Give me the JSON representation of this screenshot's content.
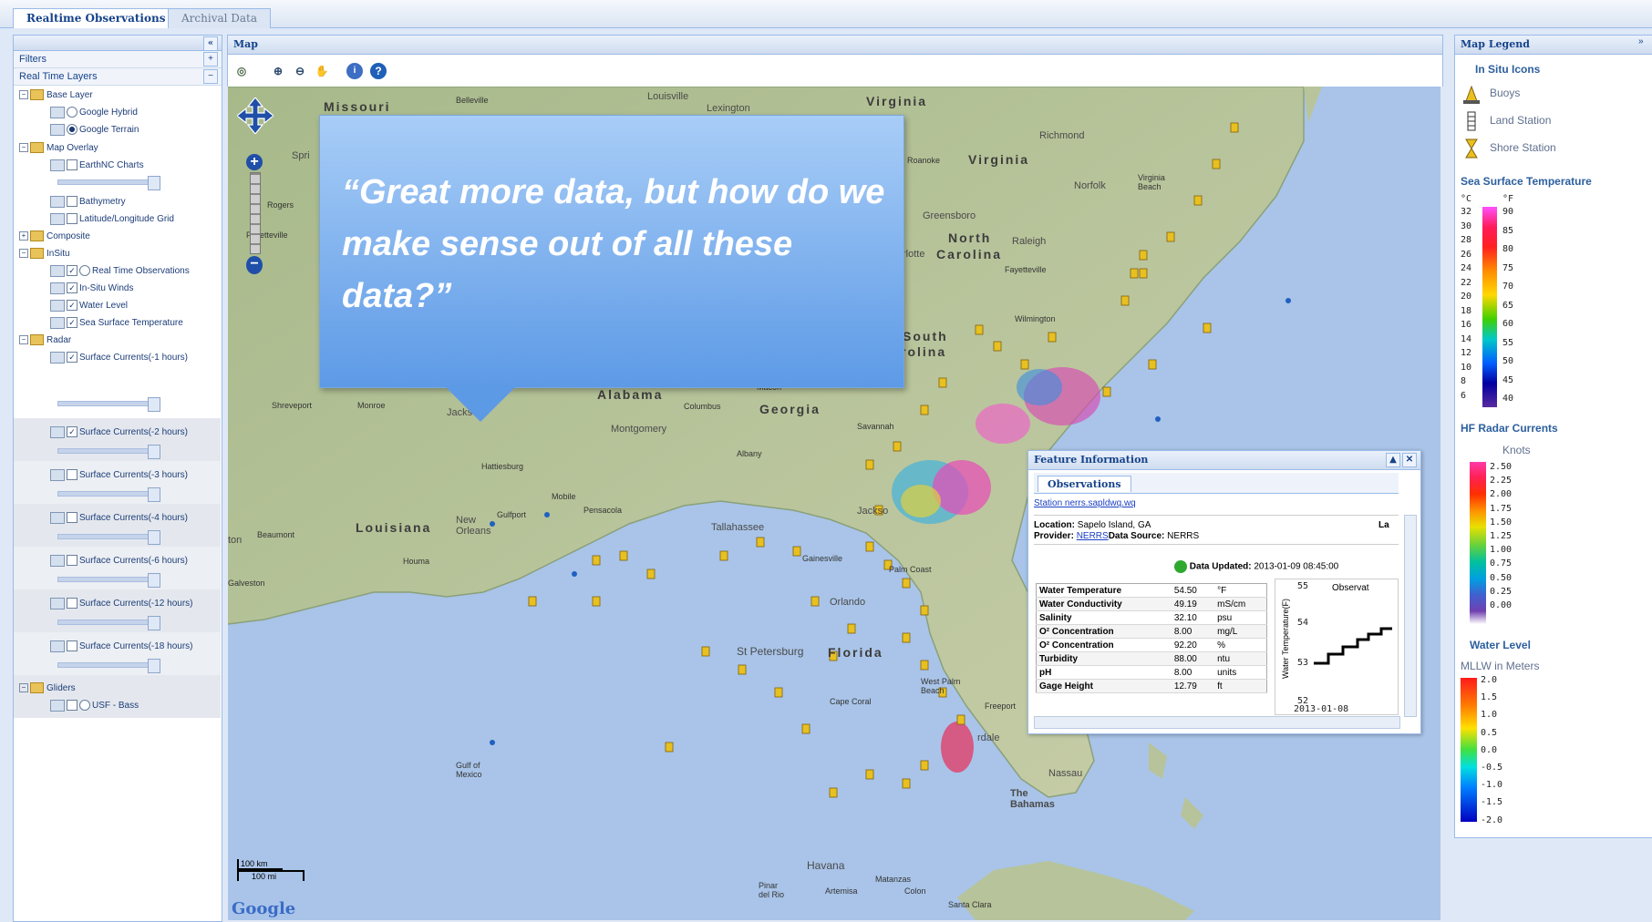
{
  "tabs": [
    {
      "label": "Realtime Observations",
      "active": true
    },
    {
      "label": "Archival Data",
      "active": false
    }
  ],
  "left_panel": {
    "collapse_glyph": "«",
    "filters_label": "Filters",
    "filters_glyph": "+",
    "layers_label": "Real Time Layers",
    "layers_glyph": "−",
    "tree": [
      {
        "label": "Base Layer"
      },
      {
        "label": "Google Hybrid"
      },
      {
        "label": "Google Terrain"
      },
      {
        "label": "Map Overlay"
      },
      {
        "label": "EarthNC Charts"
      },
      {
        "label": "Bathymetry"
      },
      {
        "label": "Latitude/Longitude Grid"
      },
      {
        "label": "Composite"
      },
      {
        "label": "InSitu"
      },
      {
        "label": "Real Time Observations"
      },
      {
        "label": "In-Situ Winds"
      },
      {
        "label": "Water Level"
      },
      {
        "label": "Sea Surface Temperature"
      },
      {
        "label": "Radar"
      },
      {
        "label": "Surface Currents(-1 hours)"
      },
      {
        "label": "Surface Currents(-2 hours)"
      },
      {
        "label": "Surface Currents(-3 hours)"
      },
      {
        "label": "Surface Currents(-4 hours)"
      },
      {
        "label": "Surface Currents(-6 hours)"
      },
      {
        "label": "Surface Currents(-12 hours)"
      },
      {
        "label": "Surface Currents(-18 hours)"
      },
      {
        "label": "Gliders"
      },
      {
        "label": "USF - Bass"
      }
    ]
  },
  "map": {
    "header": "Map",
    "scale_km": "100 km",
    "scale_mi": "100 mi",
    "attribution": "Google",
    "labels": {
      "missouri": "Missouri",
      "belleville": "Belleville",
      "louisville": "Louisville",
      "lexington": "Lexington",
      "virginia1": "Virginia",
      "virginia2": "Virginia",
      "richmond": "Richmond",
      "roanoke": "Roanoke",
      "norfolk": "Norfolk",
      "vabeach": "Virginia Beach",
      "greensboro": "Greensboro",
      "north": "North",
      "carolina": "Carolina",
      "raleigh": "Raleigh",
      "charlotte": "rlotte",
      "fayetteville": "Fayetteville",
      "wilmington": "Wilmington",
      "south": "South",
      "carolina2": "rolina",
      "alabama": "Alabama",
      "georgia": "Georgia",
      "montgomery": "Montgomery",
      "columbus": "Columbus",
      "macon": "Macon",
      "albany": "Albany",
      "savannah": "Savannah",
      "jackson": "Jackson",
      "hattiesburg": "Hattiesburg",
      "mobile": "Mobile",
      "gulfport": "Gulfport",
      "pensacola": "Pensacola",
      "tallahassee": "Tallahassee",
      "jacksonville": "Jackso",
      "gainesville": "Gainesville",
      "palmcoast": "Palm Coast",
      "louisiana": "Louisiana",
      "neworleans": "New Orleans",
      "houma": "Houma",
      "beaumont": "Beaumont",
      "houston": "ton",
      "galveston": "Galveston",
      "shreveport": "Shreveport",
      "monroe": "Monroe",
      "rogers": "Rogers",
      "fayetteville2": "Fayetteville",
      "springfield": "Spri",
      "orlando": "Orlando",
      "stpetersburg": "St Petersburg",
      "florida": "Florida",
      "capecoral": "Cape Coral",
      "westpalm": "West Palm Beach",
      "freeport": "Freeport",
      "ftlauderdale": "rdale",
      "nassau": "Nassau",
      "bahamas": "The Bahamas",
      "havana": "Havana",
      "matanzas": "Matanzas",
      "pinar": "Pinar del Rio",
      "artemisa": "Artemisa",
      "colon": "Colon",
      "santaclara": "Santa Clara",
      "gulfofmexico": "Gulf of Mexico"
    }
  },
  "callout": {
    "text": "“Great more data, but how do we make sense out of all these data?”"
  },
  "feature_info": {
    "title": "Feature Information",
    "tab": "Observations",
    "station_link": "Station nerrs.sapldwq.wq",
    "location_label": "Location:",
    "location_value": "Sapelo Island, GA",
    "lat_label": "La",
    "provider_label": "Provider:",
    "provider_value": "NERRS",
    "source_label": "Data Source:",
    "source_value": "NERRS",
    "updated_label": "Data Updated:",
    "updated_value": "2013-01-09 08:45:00",
    "rows": [
      {
        "name": "Water Temperature",
        "value": "54.50",
        "unit": "°F"
      },
      {
        "name": "Water Conductivity",
        "value": "49.19",
        "unit": "mS/cm"
      },
      {
        "name": "Salinity",
        "value": "32.10",
        "unit": "psu"
      },
      {
        "name": "O² Concentration",
        "value": "8.00",
        "unit": "mg/L"
      },
      {
        "name": "O² Concentration",
        "value": "92.20",
        "unit": "%"
      },
      {
        "name": "Turbidity",
        "value": "88.00",
        "unit": "ntu"
      },
      {
        "name": "pH",
        "value": "8.00",
        "unit": "units"
      },
      {
        "name": "Gage Height",
        "value": "12.79",
        "unit": "ft"
      }
    ],
    "chart_title": "Observat",
    "chart_ylabel": "Water Temperature(F)",
    "chart_yticks": [
      "55",
      "54",
      "53",
      "52"
    ],
    "chart_xtick": "2013-01-08"
  },
  "legend": {
    "title": "Map Legend",
    "insitu_title": "In Situ Icons",
    "icons": [
      {
        "label": "Buoys",
        "icon": "buoy-icon"
      },
      {
        "label": "Land Station",
        "icon": "land-station-icon"
      },
      {
        "label": "Shore Station",
        "icon": "shore-station-icon"
      }
    ],
    "sst_title": "Sea Surface Temperature",
    "sst_unit_c": "°C",
    "sst_unit_f": "°F",
    "sst_c_ticks": [
      "32",
      "30",
      "28",
      "26",
      "24",
      "22",
      "20",
      "18",
      "16",
      "14",
      "12",
      "10",
      "8",
      "6"
    ],
    "sst_f_ticks": [
      "90",
      "85",
      "80",
      "75",
      "70",
      "65",
      "60",
      "55",
      "50",
      "45",
      "40"
    ],
    "hf_title": "HF Radar Currents",
    "hf_unit": "Knots",
    "hf_ticks": [
      "2.50",
      "2.25",
      "2.00",
      "1.75",
      "1.50",
      "1.25",
      "1.00",
      "0.75",
      "0.50",
      "0.25",
      "0.00"
    ],
    "wl_title": "Water Level",
    "wl_unit": "MLLW in Meters",
    "wl_ticks": [
      "2.0",
      "1.5",
      "1.0",
      "0.5",
      "0.0",
      "-0.5",
      "-1.0",
      "-1.5",
      "-2.0"
    ]
  },
  "colors": {
    "panel_border": "#99bbe8",
    "header_text": "#15428b",
    "callout_top": "#a8cdf7",
    "callout_bottom": "#5d9ae6"
  }
}
